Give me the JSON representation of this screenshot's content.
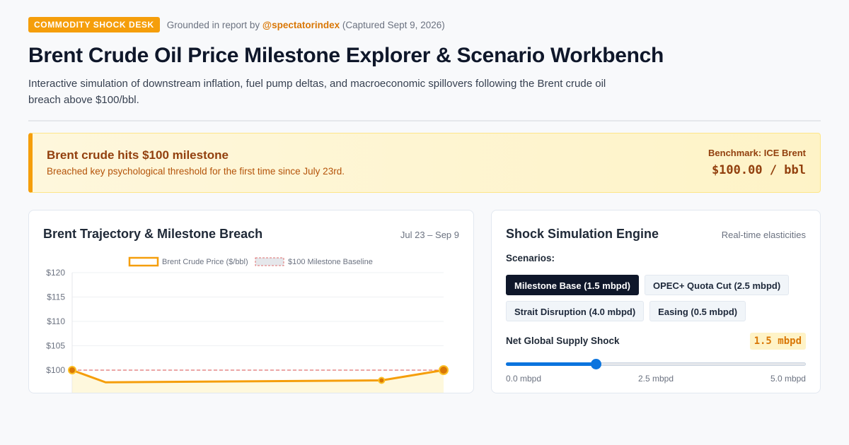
{
  "header": {
    "badge": "COMMODITY SHOCK DESK",
    "meta_prefix": "Grounded in report by",
    "handle": "@spectatorindex",
    "meta_suffix": "(Captured Sept 9, 2026)",
    "title": "Brent Crude Oil Price Milestone Explorer & Scenario Workbench",
    "subtitle": "Interactive simulation of downstream inflation, fuel pump deltas, and macroeconomic spillovers following the Brent crude oil breach above $100/bbl."
  },
  "alert": {
    "title": "Brent crude hits $100 milestone",
    "description": "Breached key psychological threshold for the first time since July 23rd.",
    "benchmark": "Benchmark: ICE Brent",
    "price": "$100.00 / bbl"
  },
  "chart_card": {
    "title": "Brent Trajectory & Milestone Breach",
    "date_range": "Jul 23 – Sep 9"
  },
  "chart_data": {
    "type": "line",
    "series": [
      {
        "name": "Brent Crude Price ($/bbl)",
        "color": "#f59e0b",
        "x_frac": [
          0,
          0.09,
          0.833,
          1
        ],
        "values": [
          100,
          97.5,
          97.9,
          100
        ]
      }
    ],
    "baseline": {
      "name": "$100 Milestone Baseline",
      "value": 100,
      "color": "#e07070"
    },
    "y_ticks": [
      "$120",
      "$115",
      "$110",
      "$105",
      "$100"
    ],
    "ylim": [
      95,
      120
    ],
    "grid": true,
    "legend_placement": "top-center"
  },
  "sim_card": {
    "title": "Shock Simulation Engine",
    "meta": "Real-time elasticities",
    "scenarios_label": "Scenarios:",
    "scenarios": [
      {
        "label": "Milestone Base (1.5 mbpd)",
        "active": true
      },
      {
        "label": "OPEC+ Quota Cut (2.5 mbpd)",
        "active": false
      },
      {
        "label": "Strait Disruption (4.0 mbpd)",
        "active": false
      },
      {
        "label": "Easing (0.5 mbpd)",
        "active": false
      }
    ],
    "shock_label": "Net Global Supply Shock",
    "shock_value": "1.5 mbpd",
    "slider": {
      "min": 0,
      "max": 5,
      "value": 1.5
    },
    "slider_ticks": [
      "0.0 mbpd",
      "2.5 mbpd",
      "5.0 mbpd"
    ]
  }
}
